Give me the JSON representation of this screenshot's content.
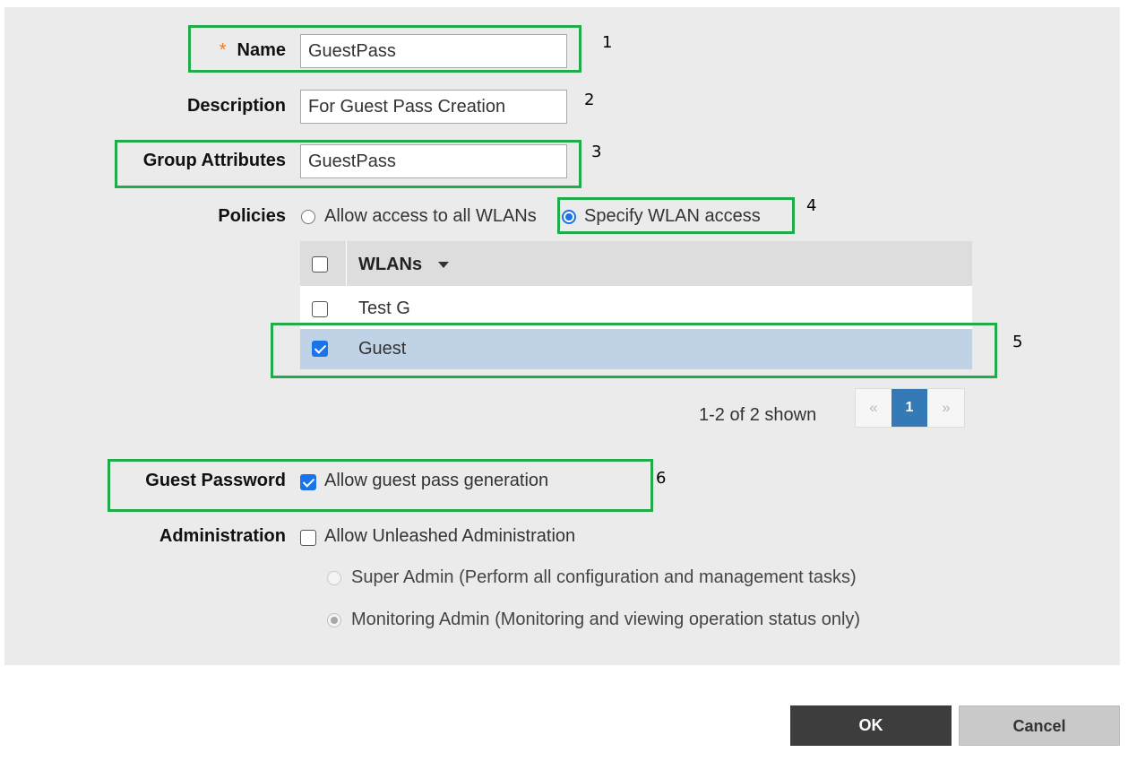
{
  "form": {
    "name": {
      "label": "Name",
      "required_mark": "*",
      "value": "GuestPass"
    },
    "description": {
      "label": "Description",
      "value": "For Guest Pass Creation"
    },
    "group_attributes": {
      "label": "Group Attributes",
      "value": "GuestPass"
    },
    "policies": {
      "label": "Policies",
      "options": [
        {
          "label": "Allow access to all WLANs",
          "selected": false
        },
        {
          "label": "Specify WLAN access",
          "selected": true
        }
      ]
    },
    "wlan_table": {
      "header": "WLANs",
      "rows": [
        {
          "name": "Test G",
          "checked": false
        },
        {
          "name": "Guest",
          "checked": true
        }
      ],
      "shown_text": "1-2 of 2 shown",
      "pagination": {
        "prev": "«",
        "current_page": "1",
        "next": "»"
      }
    },
    "guest_password": {
      "label": "Guest Password",
      "option": "Allow guest pass generation",
      "checked": true
    },
    "administration": {
      "label": "Administration",
      "option": "Allow Unleashed Administration",
      "checked": false,
      "roles": [
        {
          "label": "Super Admin (Perform all configuration and management tasks)",
          "selected": false
        },
        {
          "label": "Monitoring Admin (Monitoring and viewing operation status only)",
          "selected": true
        }
      ]
    }
  },
  "annotations": [
    "1",
    "2",
    "3",
    "4",
    "5",
    "6"
  ],
  "buttons": {
    "ok": "OK",
    "cancel": "Cancel"
  },
  "colors": {
    "highlight_box": "#22ab4a",
    "accent": "#1a73e8",
    "selected_row": "#c0d2e6",
    "required": "#f07c1e"
  }
}
